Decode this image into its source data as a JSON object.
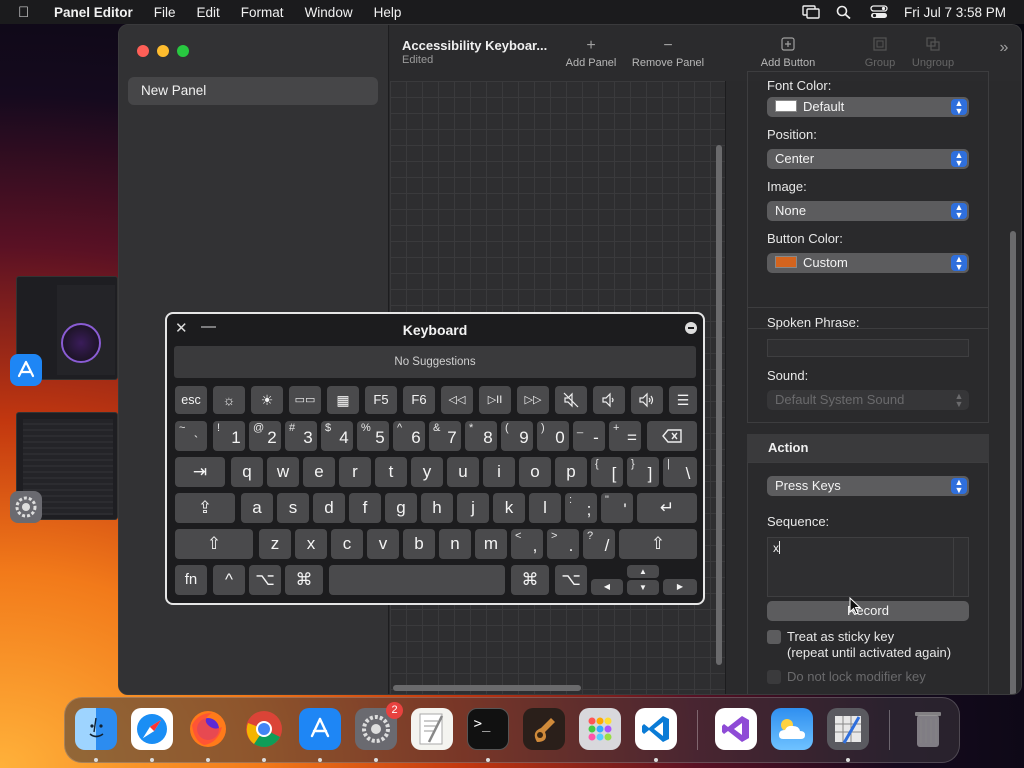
{
  "menubar": {
    "app_name": "Panel Editor",
    "menus": [
      "File",
      "Edit",
      "Format",
      "Window",
      "Help"
    ],
    "datetime": "Fri Jul 7  3:58 PM"
  },
  "sidebar": {
    "items": [
      {
        "label": "New Panel"
      }
    ]
  },
  "toolbar": {
    "doc_title": "Accessibility Keyboar...",
    "doc_status": "Edited",
    "add_panel": "Add Panel",
    "remove_panel": "Remove Panel",
    "add_button": "Add Button",
    "group": "Group",
    "ungroup": "Ungroup"
  },
  "inspector": {
    "font_color_label": "Font Color:",
    "font_color_value": "Default",
    "position_label": "Position:",
    "position_value": "Center",
    "image_label": "Image:",
    "image_value": "None",
    "button_color_label": "Button Color:",
    "button_color_value": "Custom",
    "button_color_swatch": "#d4641e",
    "spoken_phrase_label": "Spoken Phrase:",
    "spoken_phrase_value": "",
    "sound_label": "Sound:",
    "sound_value": "Default System Sound",
    "action_header": "Action",
    "action_value": "Press Keys",
    "sequence_label": "Sequence:",
    "sequence_value": "x",
    "record_label": "Record",
    "sticky_label": "Treat as sticky key",
    "sticky_sub": "(repeat until activated again)",
    "lock_modifier_label": "Do not lock modifier key"
  },
  "keyboard": {
    "title": "Keyboard",
    "suggestions": "No Suggestions",
    "fn_row": [
      "esc",
      "☼",
      "☀",
      "▭▭",
      "▦",
      "F5",
      "F6",
      "◁◁",
      "▷II",
      "▷▷",
      "🔇",
      "🔈",
      "🔊",
      "☰"
    ],
    "row1": [
      [
        "~",
        "`"
      ],
      [
        "!",
        "1"
      ],
      [
        "@",
        "2"
      ],
      [
        "#",
        "3"
      ],
      [
        "$",
        "4"
      ],
      [
        "%",
        "5"
      ],
      [
        "^",
        "6"
      ],
      [
        "&",
        "7"
      ],
      [
        "*",
        "8"
      ],
      [
        "(",
        "9"
      ],
      [
        ")",
        "0"
      ],
      [
        "_",
        "-"
      ],
      [
        "+",
        "="
      ]
    ],
    "row2": [
      "q",
      "w",
      "e",
      "r",
      "t",
      "y",
      "u",
      "i",
      "o",
      "p"
    ],
    "row2_sym": [
      [
        "{",
        "["
      ],
      [
        "}",
        "]"
      ],
      [
        "|",
        "\\"
      ]
    ],
    "row3": [
      "a",
      "s",
      "d",
      "f",
      "g",
      "h",
      "j",
      "k",
      "l"
    ],
    "row3_sym": [
      [
        ":",
        ";"
      ],
      [
        "\"",
        "'"
      ]
    ],
    "row4": [
      "z",
      "x",
      "c",
      "v",
      "b",
      "n",
      "m"
    ],
    "row4_sym": [
      [
        "<",
        ","
      ],
      [
        ">",
        "."
      ],
      [
        "?",
        "/"
      ]
    ],
    "bottom": {
      "fn": "fn",
      "ctrl": "^",
      "opt": "⌥",
      "cmd": "⌘"
    },
    "tab": "⇥",
    "delete": "⌫",
    "caps": "⇪",
    "return": "↵",
    "shift": "⇧"
  },
  "dock": {
    "settings_badge": "2"
  }
}
